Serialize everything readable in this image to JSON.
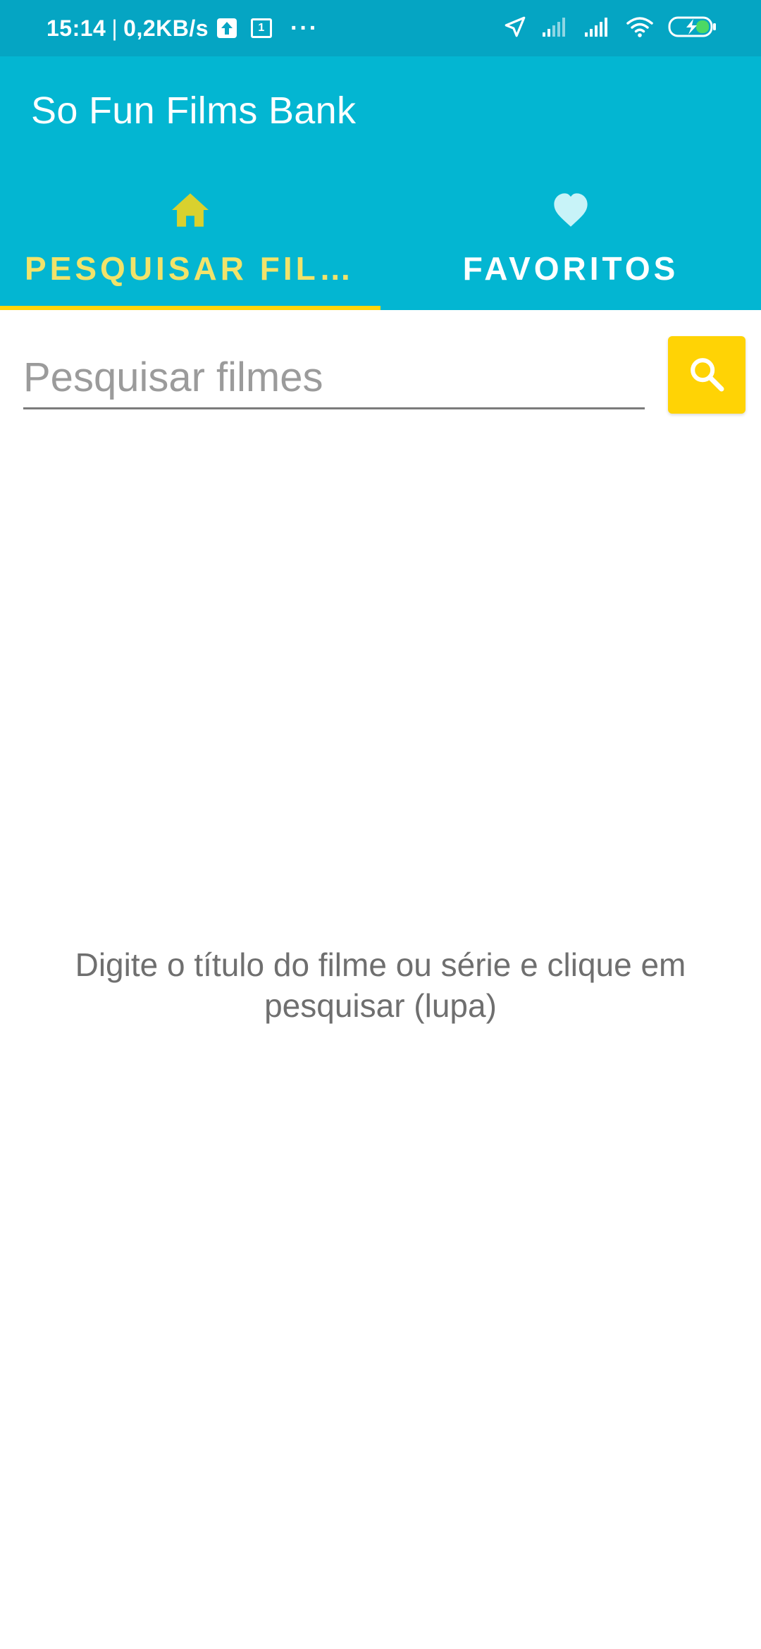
{
  "status_bar": {
    "time": "15:14",
    "separator": "|",
    "network_speed": "0,2KB/s",
    "calendar_day": "1",
    "more": "···",
    "icons": [
      "upload-icon",
      "calendar-icon",
      "location-icon",
      "signal-icon",
      "signal-icon",
      "wifi-icon",
      "battery-charging-icon"
    ]
  },
  "app_bar": {
    "title": "So Fun Films Bank"
  },
  "tabs": [
    {
      "label": "PESQUISAR FILMES",
      "icon": "home-icon",
      "active": true
    },
    {
      "label": "FAVORITOS",
      "icon": "heart-icon",
      "active": false
    }
  ],
  "search": {
    "placeholder": "Pesquisar filmes",
    "value": "",
    "button_icon": "search-icon"
  },
  "empty_state": {
    "message": "Digite o título do filme ou série e clique em pesquisar (lupa)"
  },
  "colors": {
    "status_bar": "#05a5c3",
    "app_bar": "#03b6d2",
    "accent_yellow": "#ffd305",
    "active_tab_text": "#f2e36a",
    "home_icon": "#d9d12e",
    "heart_icon": "#c8f3f8",
    "message_text": "#6f6f6f"
  }
}
